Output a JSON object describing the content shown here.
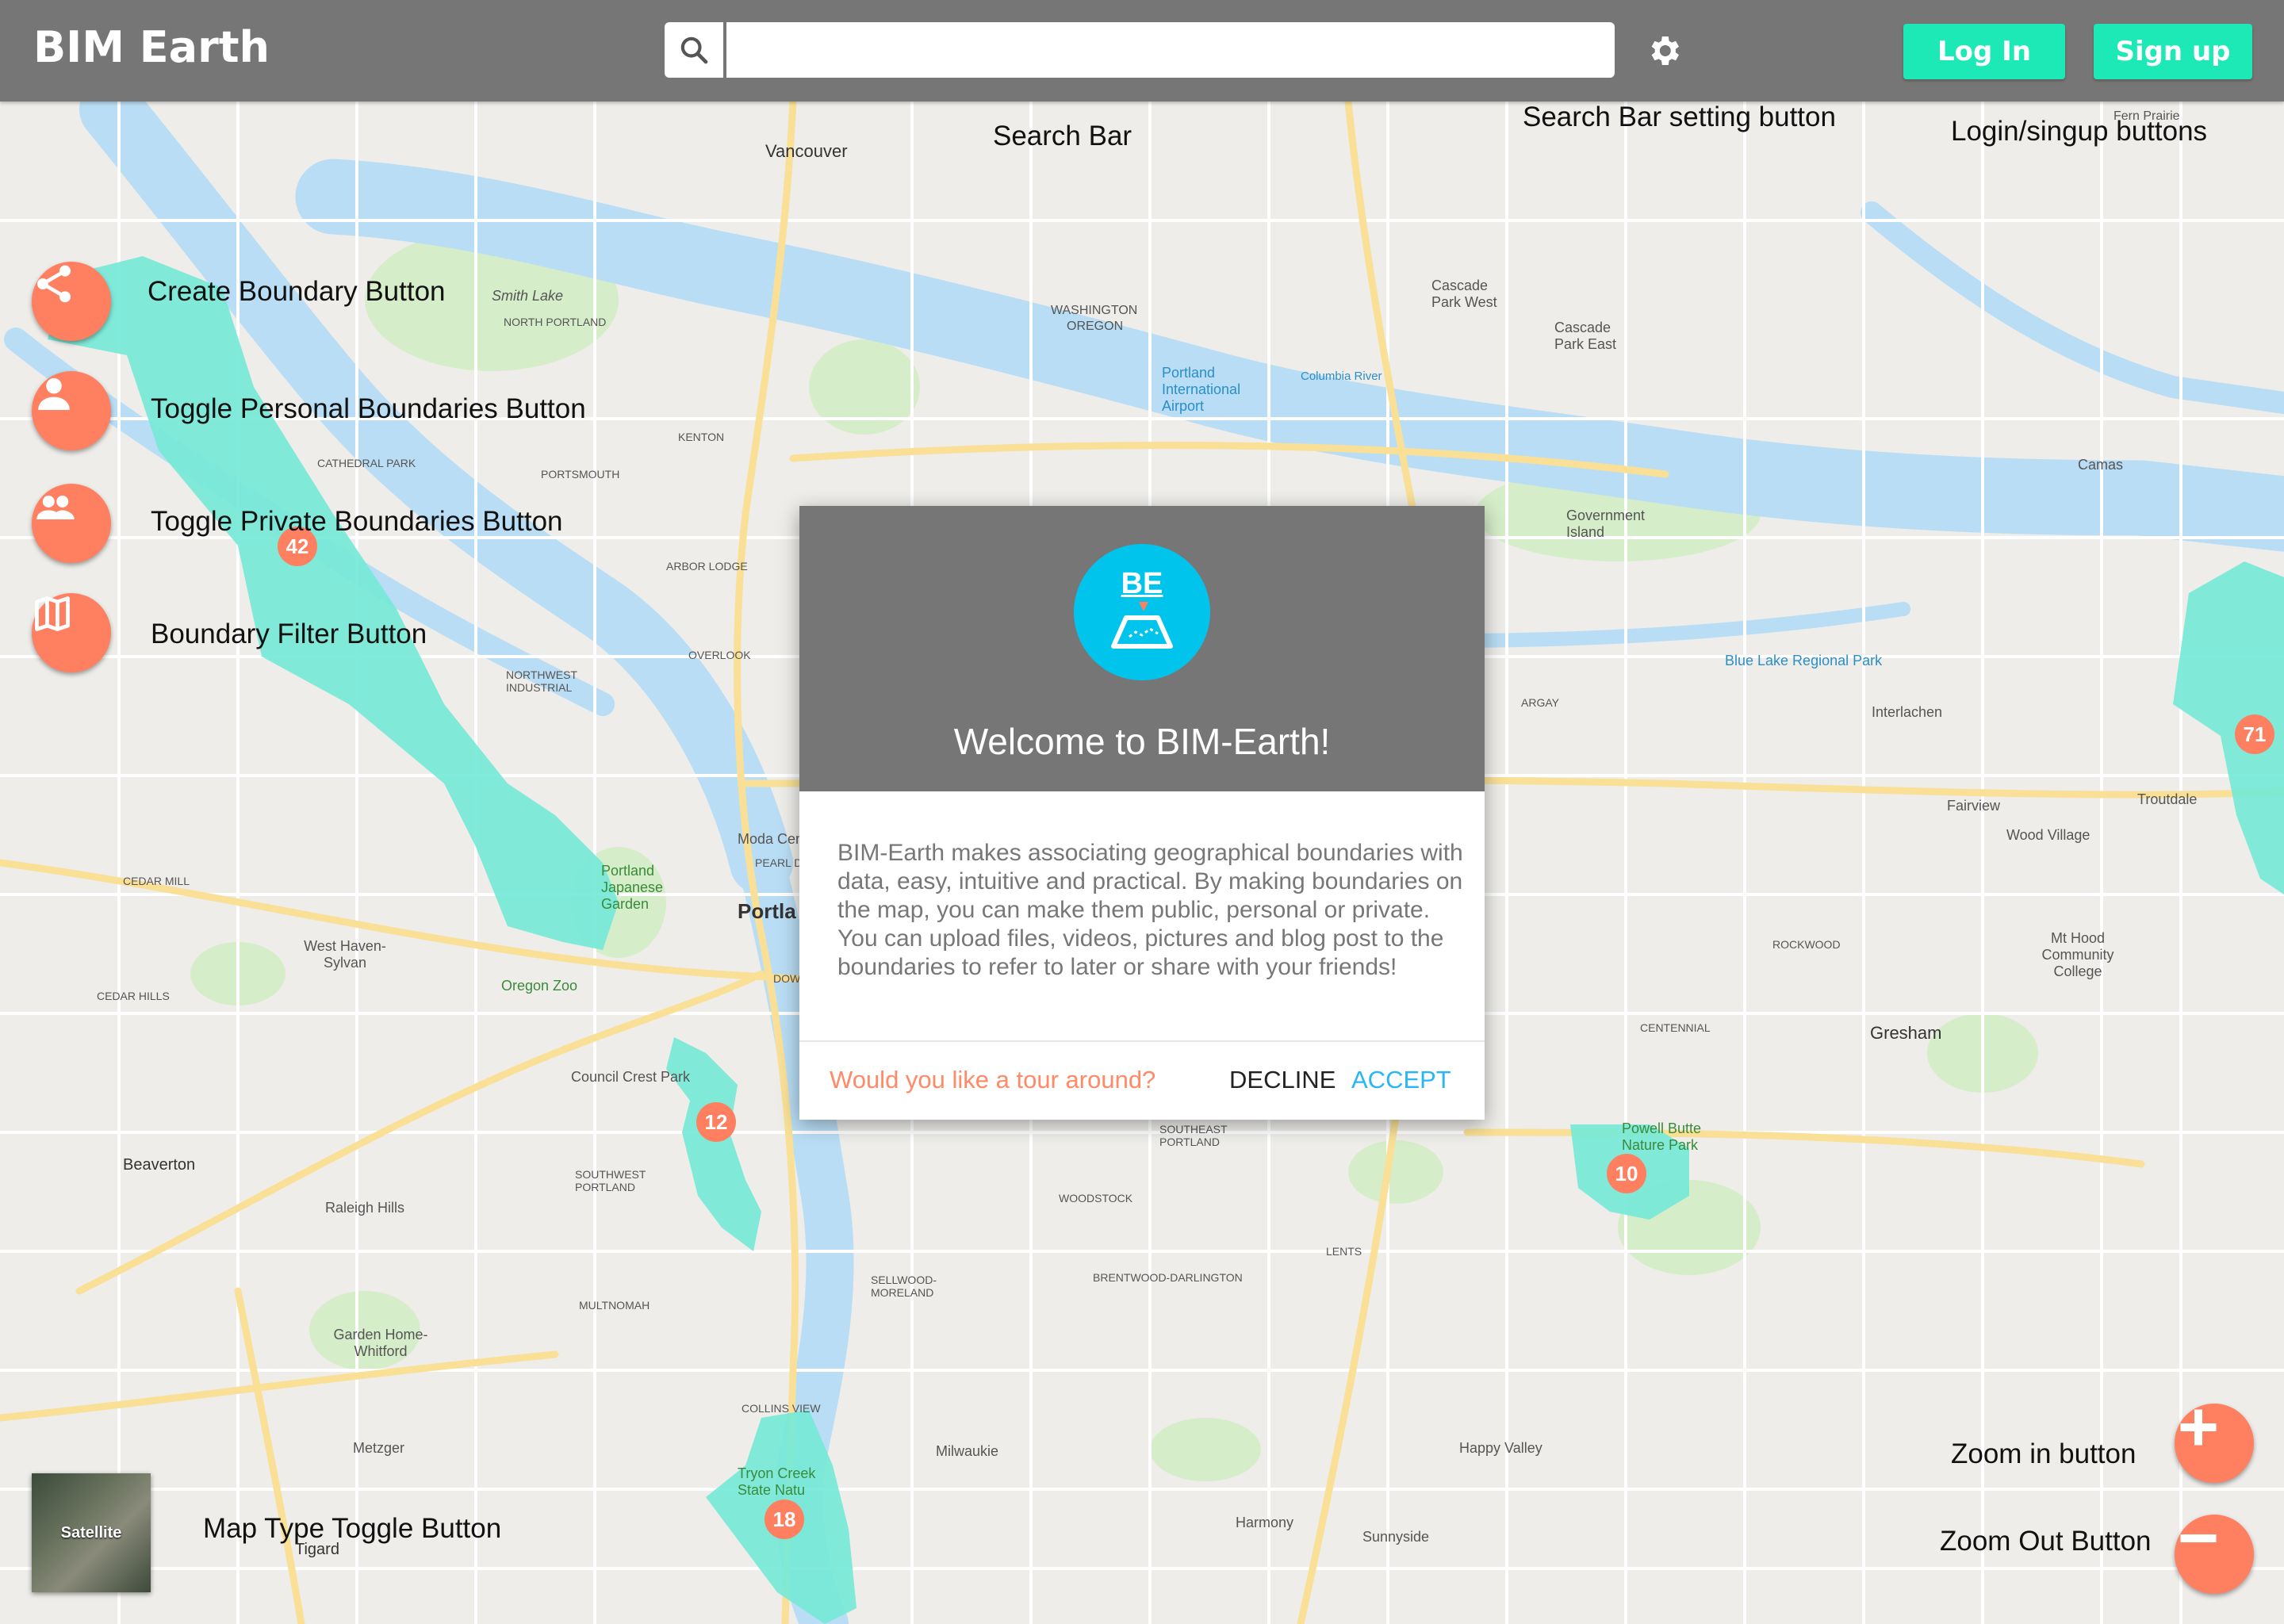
{
  "header": {
    "brand": "BIM Earth",
    "search_placeholder": "",
    "login_label": "Log In",
    "signup_label": "Sign up"
  },
  "annotations": {
    "search_bar": "Search Bar",
    "search_setting": "Search Bar setting button",
    "login_signup": "Login/singup buttons",
    "create_boundary": "Create Boundary Button",
    "toggle_personal": "Toggle Personal Boundaries Button",
    "toggle_private": "Toggle Private Boundaries Button",
    "boundary_filter": "Boundary Filter Button",
    "map_type": "Map Type Toggle Button",
    "zoom_in": "Zoom in button",
    "zoom_out": "Zoom Out Button"
  },
  "map": {
    "satellite_label": "Satellite",
    "markers": [
      "42",
      "12",
      "10",
      "18",
      "71"
    ],
    "places": {
      "vancouver": "Vancouver",
      "smith_lake": "Smith Lake",
      "north_portland": "NORTH PORTLAND",
      "washington": "WASHINGTON",
      "oregon": "OREGON",
      "airport": "Portland International Airport",
      "cascade_west": "Cascade Park West",
      "cascade_east": "Cascade Park East",
      "camas": "Camas",
      "government_island": "Government Island",
      "blue_lake": "Blue Lake Regional Park",
      "interlachen": "Interlachen",
      "fairview": "Fairview",
      "wood_village": "Wood Village",
      "troutdale": "Troutdale",
      "mt_hood": "Mt Hood Community College",
      "gresham": "Gresham",
      "portland": "Portla",
      "japanese_garden": "Portland Japanese Garden",
      "oregon_zoo": "Oregon Zoo",
      "west_haven": "West Haven-Sylvan",
      "beaverton": "Beaverton",
      "raleigh_hills": "Raleigh Hills",
      "garden_home": "Garden Home-Whitford",
      "metzger": "Metzger",
      "tigard": "Tigard",
      "council_crest": "Council Crest Park",
      "powell_butte": "Powell Butte Nature Park",
      "happy_valley": "Happy Valley",
      "milwaukie": "Milwaukie",
      "harmony": "Harmony",
      "sunnyside": "Sunnyside",
      "tryon": "Tryon Creek State Natu",
      "kenton": "KENTON",
      "portsmouth": "PORTSMOUTH",
      "cathedral_park": "CATHEDRAL PARK",
      "arbor_lodge": "ARBOR LODGE",
      "overlook": "OVERLOOK",
      "nw_industrial": "NORTHWEST INDUSTRIAL",
      "cedar_mill": "CEDAR MILL",
      "cedar_hills": "CEDAR HILLS",
      "woodstock": "WOODSTOCK",
      "sellwood": "SELLWOOD-MORELAND",
      "brentwood": "BRENTWOOD-DARLINGTON",
      "southeast": "SOUTHEAST PORTLAND",
      "southwest": "SOUTHWEST PORTLAND",
      "multnomah": "MULTNOMAH",
      "collins_view": "COLLINS VIEW",
      "argay": "ARGAY",
      "rockwood": "ROCKWOOD",
      "centennial": "CENTENNIAL",
      "lents": "LENTS",
      "moda": "Moda Cen",
      "downtown": "DOWNTOWN",
      "pearl": "PEARL DISTRIC",
      "fern_prairie": "Fern Prairie",
      "columbia_river": "Columbia River"
    }
  },
  "dialog": {
    "logo_text": "BE",
    "title": "Welcome to BIM-Earth!",
    "body": "BIM-Earth makes associating geographical boundaries with data, easy, intuitive and practical. By making boundaries on the map, you can make them public, personal or private. You can upload files, videos, pictures and blog post to the boundaries to refer to later or share with your friends!",
    "prompt": "Would you like a tour around?",
    "decline_label": "DECLINE",
    "accept_label": "ACCEPT"
  },
  "colors": {
    "header": "#767676",
    "accent_green": "#1de9b6",
    "fab_orange": "#ff7f61",
    "logo_cyan": "#00c4ec",
    "boundary_teal": "#3ee0c8",
    "water": "#9fd0f0",
    "road_yellow": "#f7d56e"
  },
  "icons": [
    "search-icon",
    "gear-icon",
    "share-icon",
    "person-icon",
    "group-icon",
    "map-icon",
    "plus-icon",
    "minus-icon"
  ]
}
